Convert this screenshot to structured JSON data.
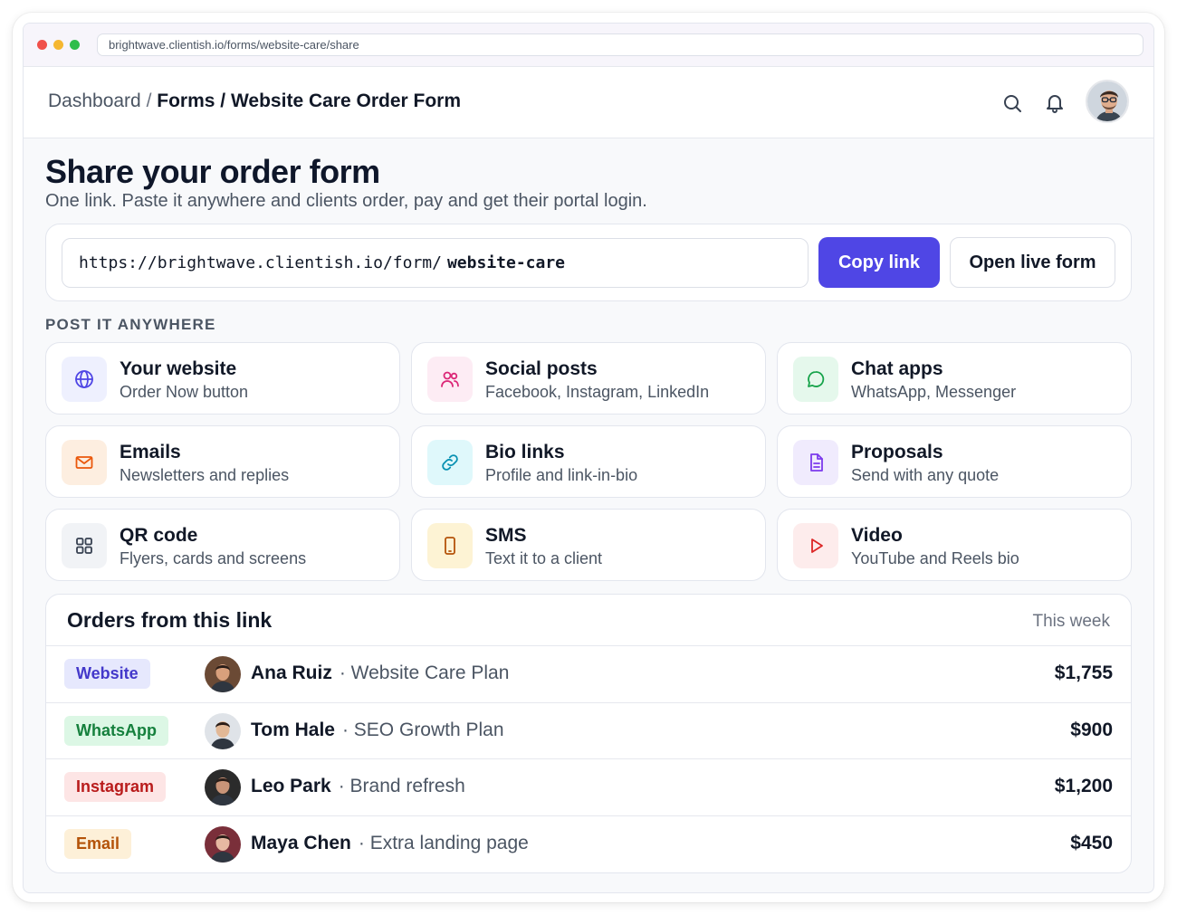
{
  "browser": {
    "url": "brightwave.clientish.io/forms/website-care/share"
  },
  "header": {
    "breadcrumb": {
      "root": "Dashboard",
      "separator": "/",
      "section": "Forms",
      "current": "Website Care Order Form"
    },
    "search_icon": "search-icon",
    "notifications_icon": "bell-icon",
    "avatar_icon": "user-avatar"
  },
  "page": {
    "title": "Share your order form",
    "subtitle": "One link. Paste it anywhere and clients order, pay and get their portal login."
  },
  "share": {
    "link_base": "https://brightwave.clientish.io/form/",
    "link_slug": "website-care",
    "copy_label": "Copy link",
    "open_label": "Open live form"
  },
  "channels": {
    "section_label": "POST IT ANYWHERE",
    "items": [
      {
        "title": "Your website",
        "subtitle": "Order Now button",
        "icon": "globe-icon",
        "icon_color": "#4f46e5",
        "icon_bg": "#eef0fe"
      },
      {
        "title": "Social posts",
        "subtitle": "Facebook, Instagram, LinkedIn",
        "icon": "users-icon",
        "icon_color": "#db2777",
        "icon_bg": "#fdecf4"
      },
      {
        "title": "Chat apps",
        "subtitle": "WhatsApp, Messenger",
        "icon": "chat-bubble-icon",
        "icon_color": "#16a34a",
        "icon_bg": "#e5f8ec"
      },
      {
        "title": "Emails",
        "subtitle": "Newsletters and replies",
        "icon": "mail-icon",
        "icon_color": "#ea580c",
        "icon_bg": "#fdeee0"
      },
      {
        "title": "Bio links",
        "subtitle": "Profile and link-in-bio",
        "icon": "link-icon",
        "icon_color": "#0891b2",
        "icon_bg": "#dff8fb"
      },
      {
        "title": "Proposals",
        "subtitle": "Send with any quote",
        "icon": "document-icon",
        "icon_color": "#7c3aed",
        "icon_bg": "#f0ebfd"
      },
      {
        "title": "QR code",
        "subtitle": "Flyers, cards and screens",
        "icon": "grid-icon",
        "icon_color": "#374151",
        "icon_bg": "#f1f3f6"
      },
      {
        "title": "SMS",
        "subtitle": "Text it to a client",
        "icon": "phone-icon",
        "icon_color": "#b45309",
        "icon_bg": "#fdf3d4"
      },
      {
        "title": "Video",
        "subtitle": "YouTube and Reels bio",
        "icon": "play-icon",
        "icon_color": "#dc2626",
        "icon_bg": "#fdecec"
      }
    ]
  },
  "orders": {
    "title": "Orders from this link",
    "period": "This week",
    "rows": [
      {
        "source": "Website",
        "badge_bg": "#e6e8fd",
        "badge_color": "#4338ca",
        "name": "Ana Ruiz",
        "plan": "· Website Care Plan",
        "amount": "$1,755",
        "avatar_bg": "#6b4a35",
        "avatar_face": "#d9a07c"
      },
      {
        "source": "WhatsApp",
        "badge_bg": "#dcf7e5",
        "badge_color": "#15803d",
        "name": "Tom Hale",
        "plan": "· SEO Growth Plan",
        "amount": "$900",
        "avatar_bg": "#dfe3e8",
        "avatar_face": "#e2b896"
      },
      {
        "source": "Instagram",
        "badge_bg": "#fde5e5",
        "badge_color": "#b91c1c",
        "name": "Leo Park",
        "plan": "· Brand refresh",
        "amount": "$1,200",
        "avatar_bg": "#2b2b2b",
        "avatar_face": "#c99478"
      },
      {
        "source": "Email",
        "badge_bg": "#fdf0d8",
        "badge_color": "#b45309",
        "name": "Maya Chen",
        "plan": "· Extra landing page",
        "amount": "$450",
        "avatar_bg": "#7a2f3a",
        "avatar_face": "#e7b9a2"
      }
    ]
  }
}
